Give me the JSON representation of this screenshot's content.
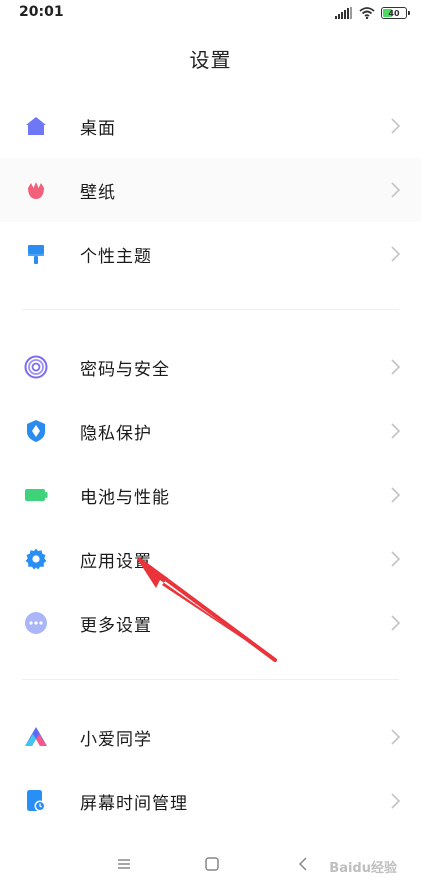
{
  "status": {
    "time": "20:01",
    "battery": "40",
    "icons": [
      "signal-icon",
      "wifi-icon",
      "battery-icon"
    ]
  },
  "title": "设置",
  "groups": [
    {
      "items": [
        {
          "label": "桌面",
          "icon": "home-icon",
          "color": "#6e77f5"
        },
        {
          "label": "壁纸",
          "icon": "tulip-icon",
          "color": "#f2607a"
        },
        {
          "label": "个性主题",
          "icon": "brush-icon",
          "color": "#2c8cf0"
        }
      ]
    },
    {
      "items": [
        {
          "label": "密码与安全",
          "icon": "fingerprint-icon",
          "color": "#7b6cf0"
        },
        {
          "label": "隐私保护",
          "icon": "shield-icon",
          "color": "#2b8cf0"
        },
        {
          "label": "电池与性能",
          "icon": "battery-icon",
          "color": "#3ed37a"
        },
        {
          "label": "应用设置",
          "icon": "gear-icon",
          "color": "#2a8ff5"
        },
        {
          "label": "更多设置",
          "icon": "more-icon",
          "color": "#6f86f5"
        }
      ]
    },
    {
      "items": [
        {
          "label": "小爱同学",
          "icon": "xiaoai-icon",
          "color": "#5a6cf5"
        },
        {
          "label": "屏幕时间管理",
          "icon": "screen-time-icon",
          "color": "#2a8ff5"
        }
      ]
    }
  ],
  "navbar": [
    "menu-icon",
    "home-square-icon",
    "back-icon"
  ],
  "annotation": {
    "color": "#e8343a"
  },
  "watermark": "Baidu经验"
}
